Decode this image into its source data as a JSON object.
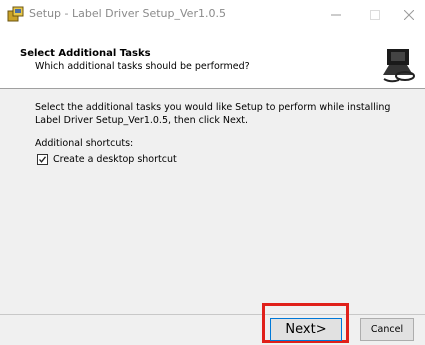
{
  "window": {
    "title": "Setup - Label Driver Setup_Ver1.0.5",
    "icon": "setup-installer-icon",
    "controls": {
      "minimize": "–",
      "maximize": "□",
      "close": "✕"
    }
  },
  "header": {
    "title": "Select Additional Tasks",
    "subtitle": "Which additional tasks should be performed?",
    "image": "wizard-computer-icon"
  },
  "content": {
    "intro": "Select the additional tasks you would like Setup to perform while installing Label Driver Setup_Ver1.0.5, then click Next.",
    "shortcuts_heading": "Additional shortcuts:",
    "tasks": [
      {
        "label": "Create a desktop shortcut",
        "checked": true
      }
    ]
  },
  "footer": {
    "next_label": "Next>",
    "cancel_label": "Cancel"
  },
  "colors": {
    "highlight": "#e0201a",
    "window_bg": "#f0f0f0",
    "title_text": "#8a8a8a"
  }
}
